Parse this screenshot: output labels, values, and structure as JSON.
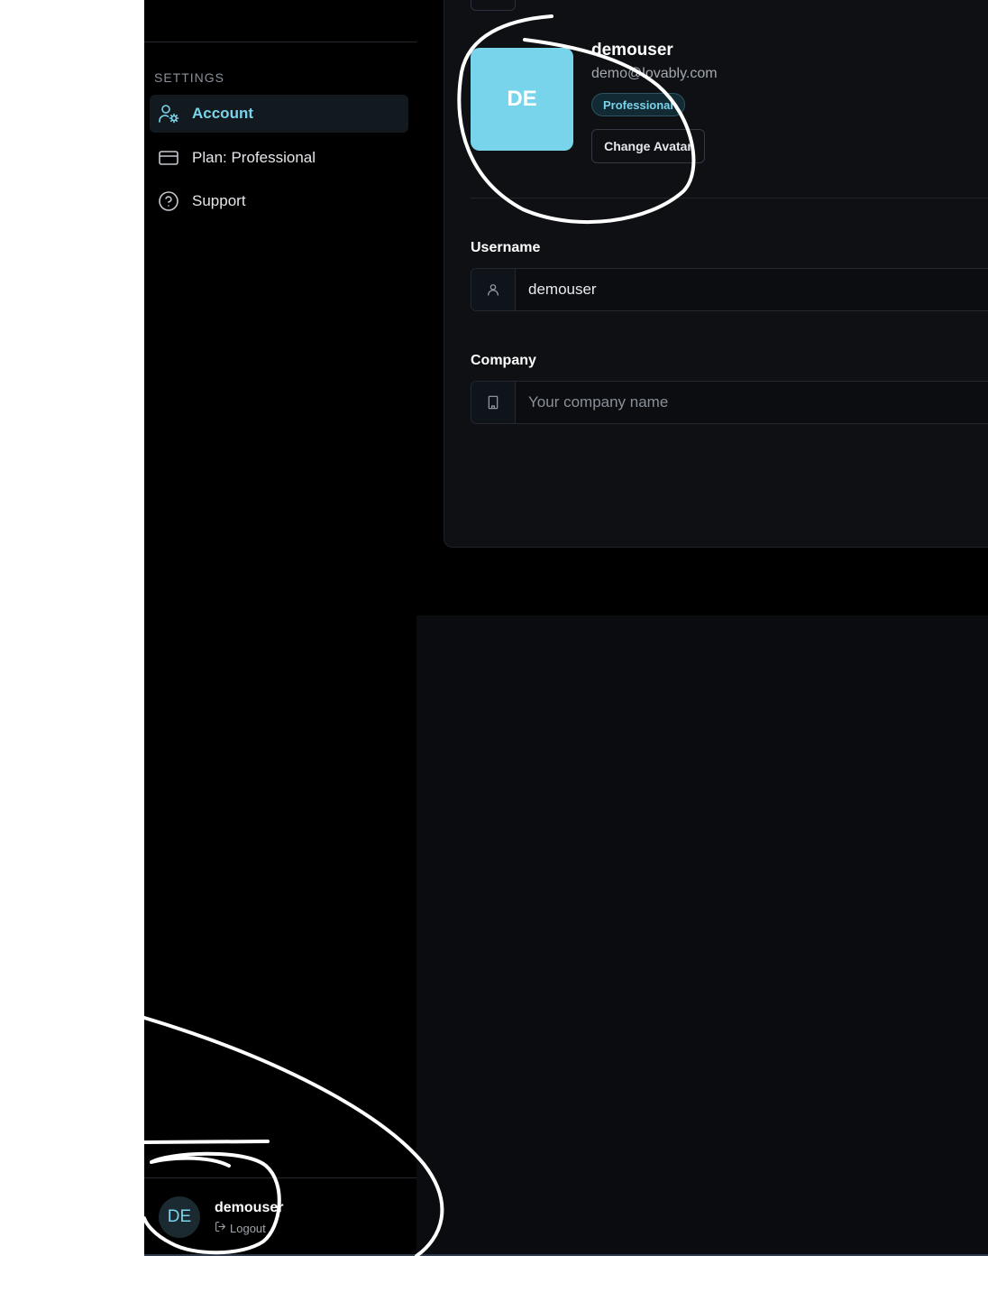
{
  "sidebar": {
    "section_heading": "SETTINGS",
    "items": [
      {
        "label": "Account",
        "icon": "user-gear-icon",
        "active": true
      },
      {
        "label": "Plan: Professional",
        "icon": "credit-card-icon",
        "active": false
      },
      {
        "label": "Support",
        "icon": "help-circle-icon",
        "active": false
      }
    ],
    "user": {
      "initials": "DE",
      "name": "demouser",
      "logout_label": "Logout"
    }
  },
  "profile": {
    "initials": "DE",
    "username": "demouser",
    "email": "demo@lovably.com",
    "plan_badge": "Professional",
    "change_avatar_label": "Change Avatar"
  },
  "form": {
    "username": {
      "label": "Username",
      "value": "demouser",
      "icon": "user-icon"
    },
    "company": {
      "label": "Company",
      "value": "",
      "placeholder": "Your company name",
      "icon": "building-icon"
    }
  },
  "colors": {
    "accent": "#7ad3ea",
    "avatar_bg": "#78d4ea",
    "sidebar_bg": "#000000",
    "main_bg": "#0b0c0f",
    "annotation_stroke": "#ffffff"
  }
}
